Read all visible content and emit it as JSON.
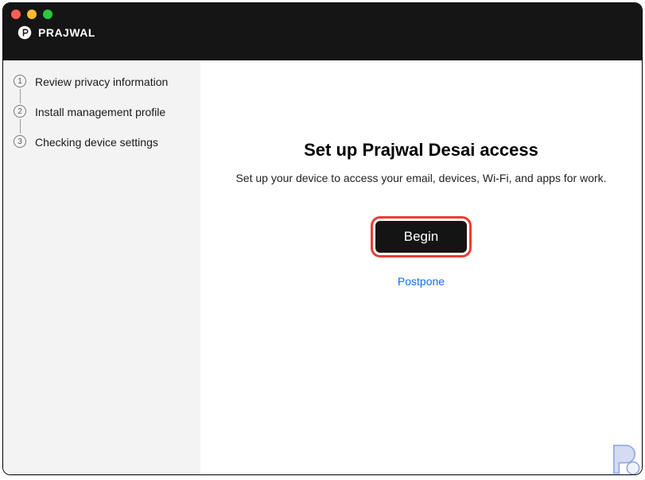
{
  "brand": {
    "name": "PRAJWAL"
  },
  "sidebar": {
    "steps": [
      {
        "num": "1",
        "label": "Review privacy information"
      },
      {
        "num": "2",
        "label": "Install management profile"
      },
      {
        "num": "3",
        "label": "Checking device settings"
      }
    ]
  },
  "main": {
    "title": "Set up Prajwal Desai access",
    "subtitle": "Set up your device to access your email, devices, Wi-Fi, and apps for work.",
    "begin_label": "Begin",
    "postpone_label": "Postpone"
  }
}
